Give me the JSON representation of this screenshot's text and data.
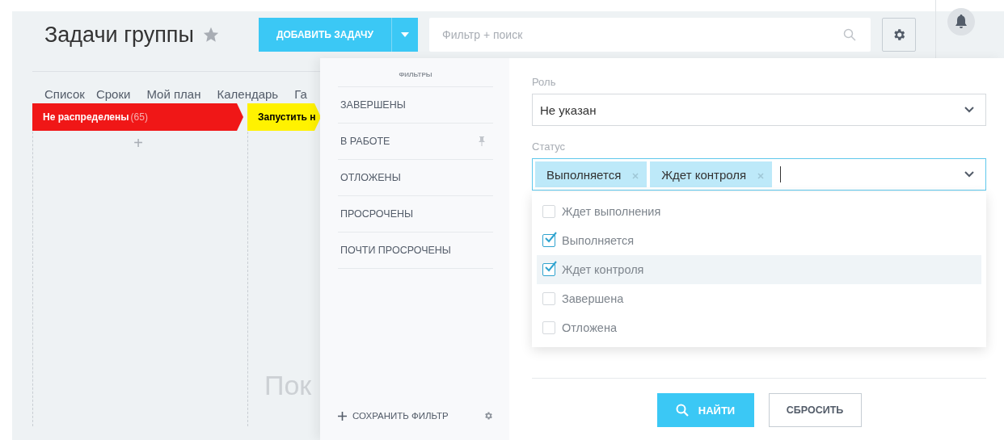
{
  "header": {
    "title": "Задачи группы",
    "favorite": false,
    "add_button": "ДОБАВИТЬ ЗАДАЧУ",
    "search": {
      "placeholder": "Фильтр + поиск"
    }
  },
  "nav": [
    "Список",
    "Сроки",
    "Мой план",
    "Календарь",
    "Га"
  ],
  "columns": [
    {
      "title": "Не распределены",
      "count": "(65)",
      "color": "#f01717"
    },
    {
      "title": "Запустить н",
      "color": "#fff200"
    }
  ],
  "add_symbol": "+",
  "empty_text": "Пок",
  "filter_panel": {
    "heading": "ФИЛЬТРЫ",
    "presets": [
      {
        "label": "ЗАВЕРШЕНЫ",
        "pinned": false
      },
      {
        "label": "В РАБОТЕ",
        "pinned": true
      },
      {
        "label": "ОТЛОЖЕНЫ",
        "pinned": false
      },
      {
        "label": "ПРОСРОЧЕНЫ",
        "pinned": false
      },
      {
        "label": "ПОЧТИ ПРОСРОЧЕНЫ",
        "pinned": false
      }
    ],
    "save_filter": "СОХРАНИТЬ ФИЛЬТР"
  },
  "form": {
    "role_label": "Роль",
    "role_value": "Не указан",
    "status_label": "Статус",
    "tags": [
      "Выполняется",
      "Ждет контроля"
    ],
    "options": [
      {
        "label": "Ждет выполнения",
        "checked": false,
        "highlighted": false
      },
      {
        "label": "Выполняется",
        "checked": true,
        "highlighted": false
      },
      {
        "label": "Ждет контроля",
        "checked": true,
        "highlighted": true
      },
      {
        "label": "Завершена",
        "checked": false,
        "highlighted": false
      },
      {
        "label": "Отложена",
        "checked": false,
        "highlighted": false
      }
    ],
    "find_button": "НАЙТИ",
    "reset_button": "СБРОСИТЬ"
  }
}
